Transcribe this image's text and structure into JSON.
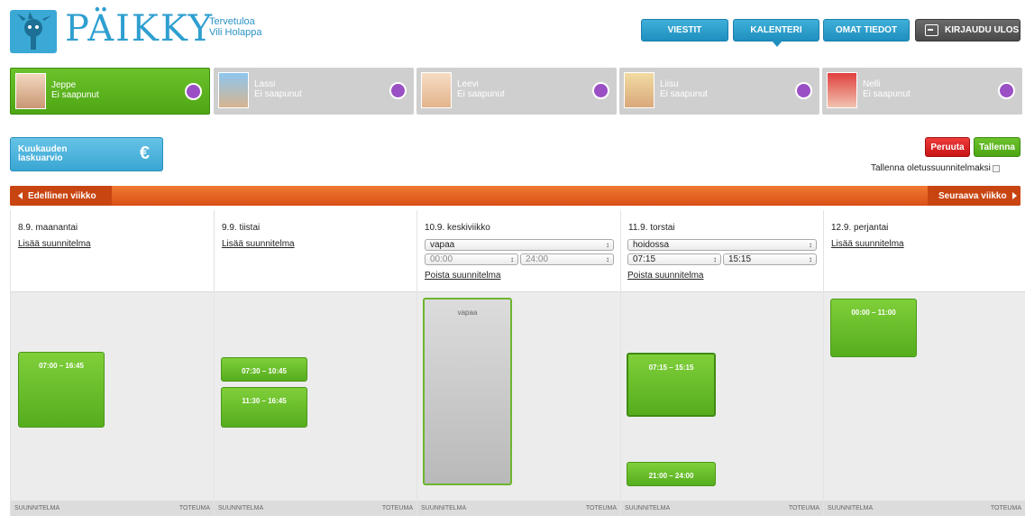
{
  "header": {
    "logo_text": "PÄIKKY",
    "welcome_line1": "Tervetuloa",
    "welcome_line2": "Vili Holappa",
    "nav": {
      "viestit": "VIESTIT",
      "kalenteri": "KALENTERI",
      "omat_tiedot": "OMAT TIEDOT",
      "logout": "KIRJAUDU ULOS"
    }
  },
  "children": [
    {
      "name": "Jeppe",
      "status": "Ei saapunut",
      "active": true
    },
    {
      "name": "Lassi",
      "status": "Ei saapunut",
      "active": false
    },
    {
      "name": "Leevi",
      "status": "Ei saapunut",
      "active": false
    },
    {
      "name": "Liisu",
      "status": "Ei saapunut",
      "active": false
    },
    {
      "name": "Nelli",
      "status": "Ei saapunut",
      "active": false
    }
  ],
  "invoice": {
    "label": "Kuukauden laskuarvio",
    "symbol": "€"
  },
  "actions": {
    "cancel": "Peruuta",
    "save": "Tallenna",
    "save_default": "Tallenna oletussuunnitelmaksi"
  },
  "week_nav": {
    "prev": "Edellinen viikko",
    "next": "Seuraava viikko"
  },
  "days": [
    {
      "title": "8.9. maanantai",
      "add_plan": "Lisää suunnitelma",
      "blocks": [
        {
          "time": "07:00 – 16:45"
        }
      ],
      "foot_left": "SUUNNITELMA",
      "foot_right": "TOTEUMA"
    },
    {
      "title": "9.9. tiistai",
      "add_plan": "Lisää suunnitelma",
      "blocks": [
        {
          "time": "07:30 – 10:45"
        },
        {
          "time": "11:30 – 16:45"
        }
      ],
      "foot_left": "SUUNNITELMA",
      "foot_right": "TOTEUMA"
    },
    {
      "title": "10.9. keskiviikko",
      "type_value": "vapaa",
      "start_value": "00:00",
      "end_value": "24:00",
      "remove_plan": "Poista suunnitelma",
      "blocks": [
        {
          "time": "vapaa"
        }
      ],
      "foot_left": "SUUNNITELMA",
      "foot_right": "TOTEUMA"
    },
    {
      "title": "11.9. torstai",
      "type_value": "hoidossa",
      "start_value": "07:15",
      "end_value": "15:15",
      "remove_plan": "Poista suunnitelma",
      "blocks": [
        {
          "time": "07:15 – 15:15"
        },
        {
          "time": "21:00 – 24:00"
        }
      ],
      "foot_left": "SUUNNITELMA",
      "foot_right": "TOTEUMA"
    },
    {
      "title": "12.9. perjantai",
      "add_plan": "Lisää suunnitelma",
      "blocks": [
        {
          "time": "00:00 – 11:00"
        }
      ],
      "foot_left": "SUUNNITELMA",
      "foot_right": "TOTEUMA"
    }
  ]
}
